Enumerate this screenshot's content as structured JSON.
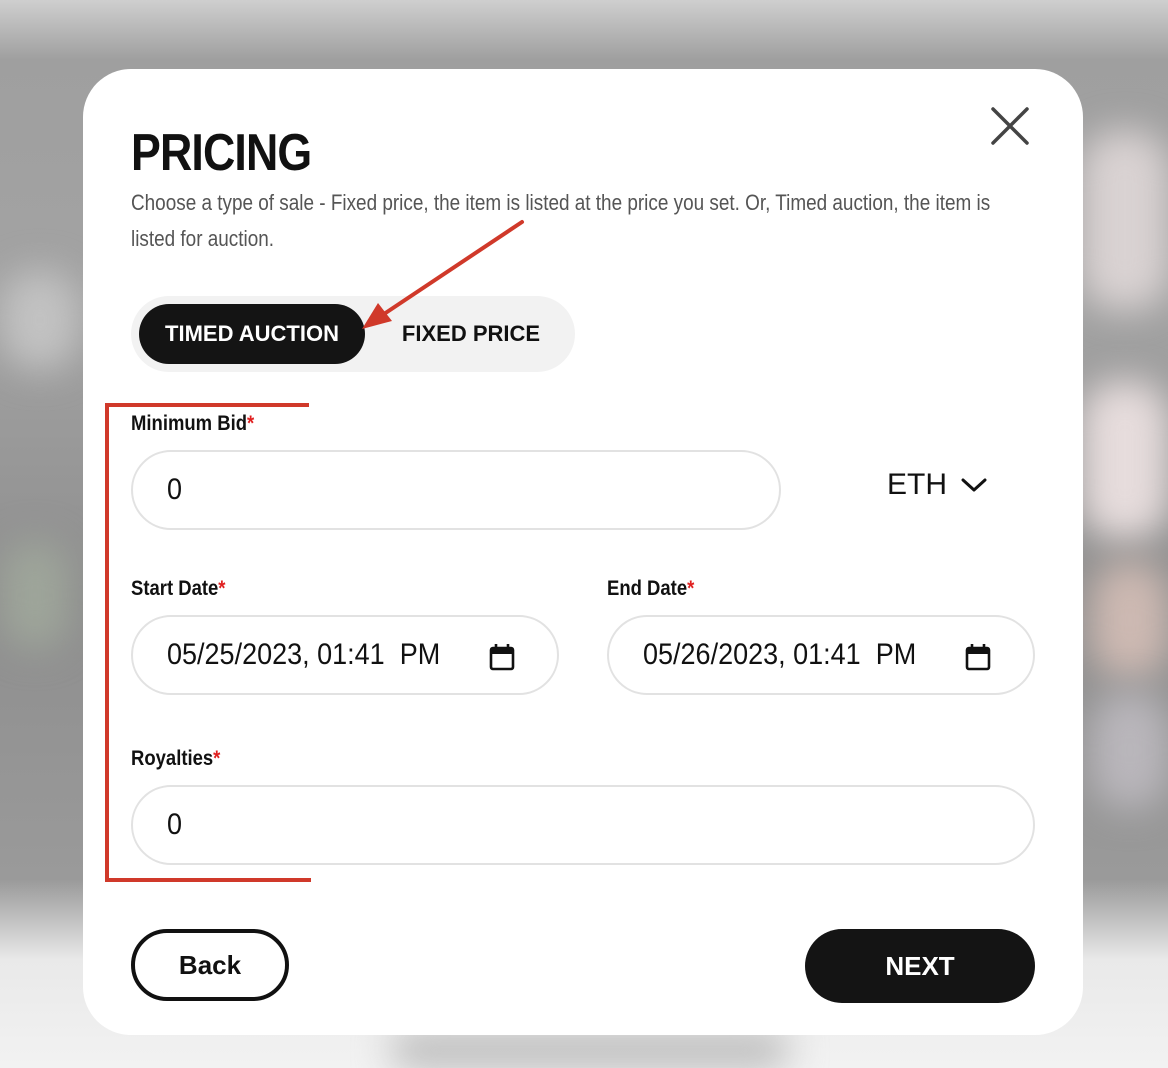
{
  "dialog": {
    "title": "PRICING",
    "description": "Choose a type of sale - Fixed price, the item is listed at the price you set. Or, Timed auction, the item is listed for auction."
  },
  "sale_type_toggle": {
    "options": [
      {
        "label": "TIMED AUCTION",
        "selected": true
      },
      {
        "label": "FIXED PRICE",
        "selected": false
      }
    ]
  },
  "form": {
    "minimum_bid": {
      "label": "Minimum Bid",
      "required_marker": "*",
      "value": "0"
    },
    "currency": {
      "selected": "ETH",
      "icon": "chevron-down-icon"
    },
    "start_date": {
      "label": "Start Date",
      "required_marker": "*",
      "value": "05/25/2023, 01:41  PM",
      "icon": "calendar-icon"
    },
    "end_date": {
      "label": "End Date",
      "required_marker": "*",
      "value": "05/26/2023, 01:41  PM",
      "icon": "calendar-icon"
    },
    "royalties": {
      "label": "Royalties",
      "required_marker": "*",
      "value": "0"
    }
  },
  "actions": {
    "back_label": "Back",
    "next_label": "NEXT"
  },
  "annotation": {
    "color": "#d0392a"
  },
  "colors": {
    "primary_dark": "#141414",
    "required": "#e02020",
    "field_border": "#e2e2e2"
  }
}
